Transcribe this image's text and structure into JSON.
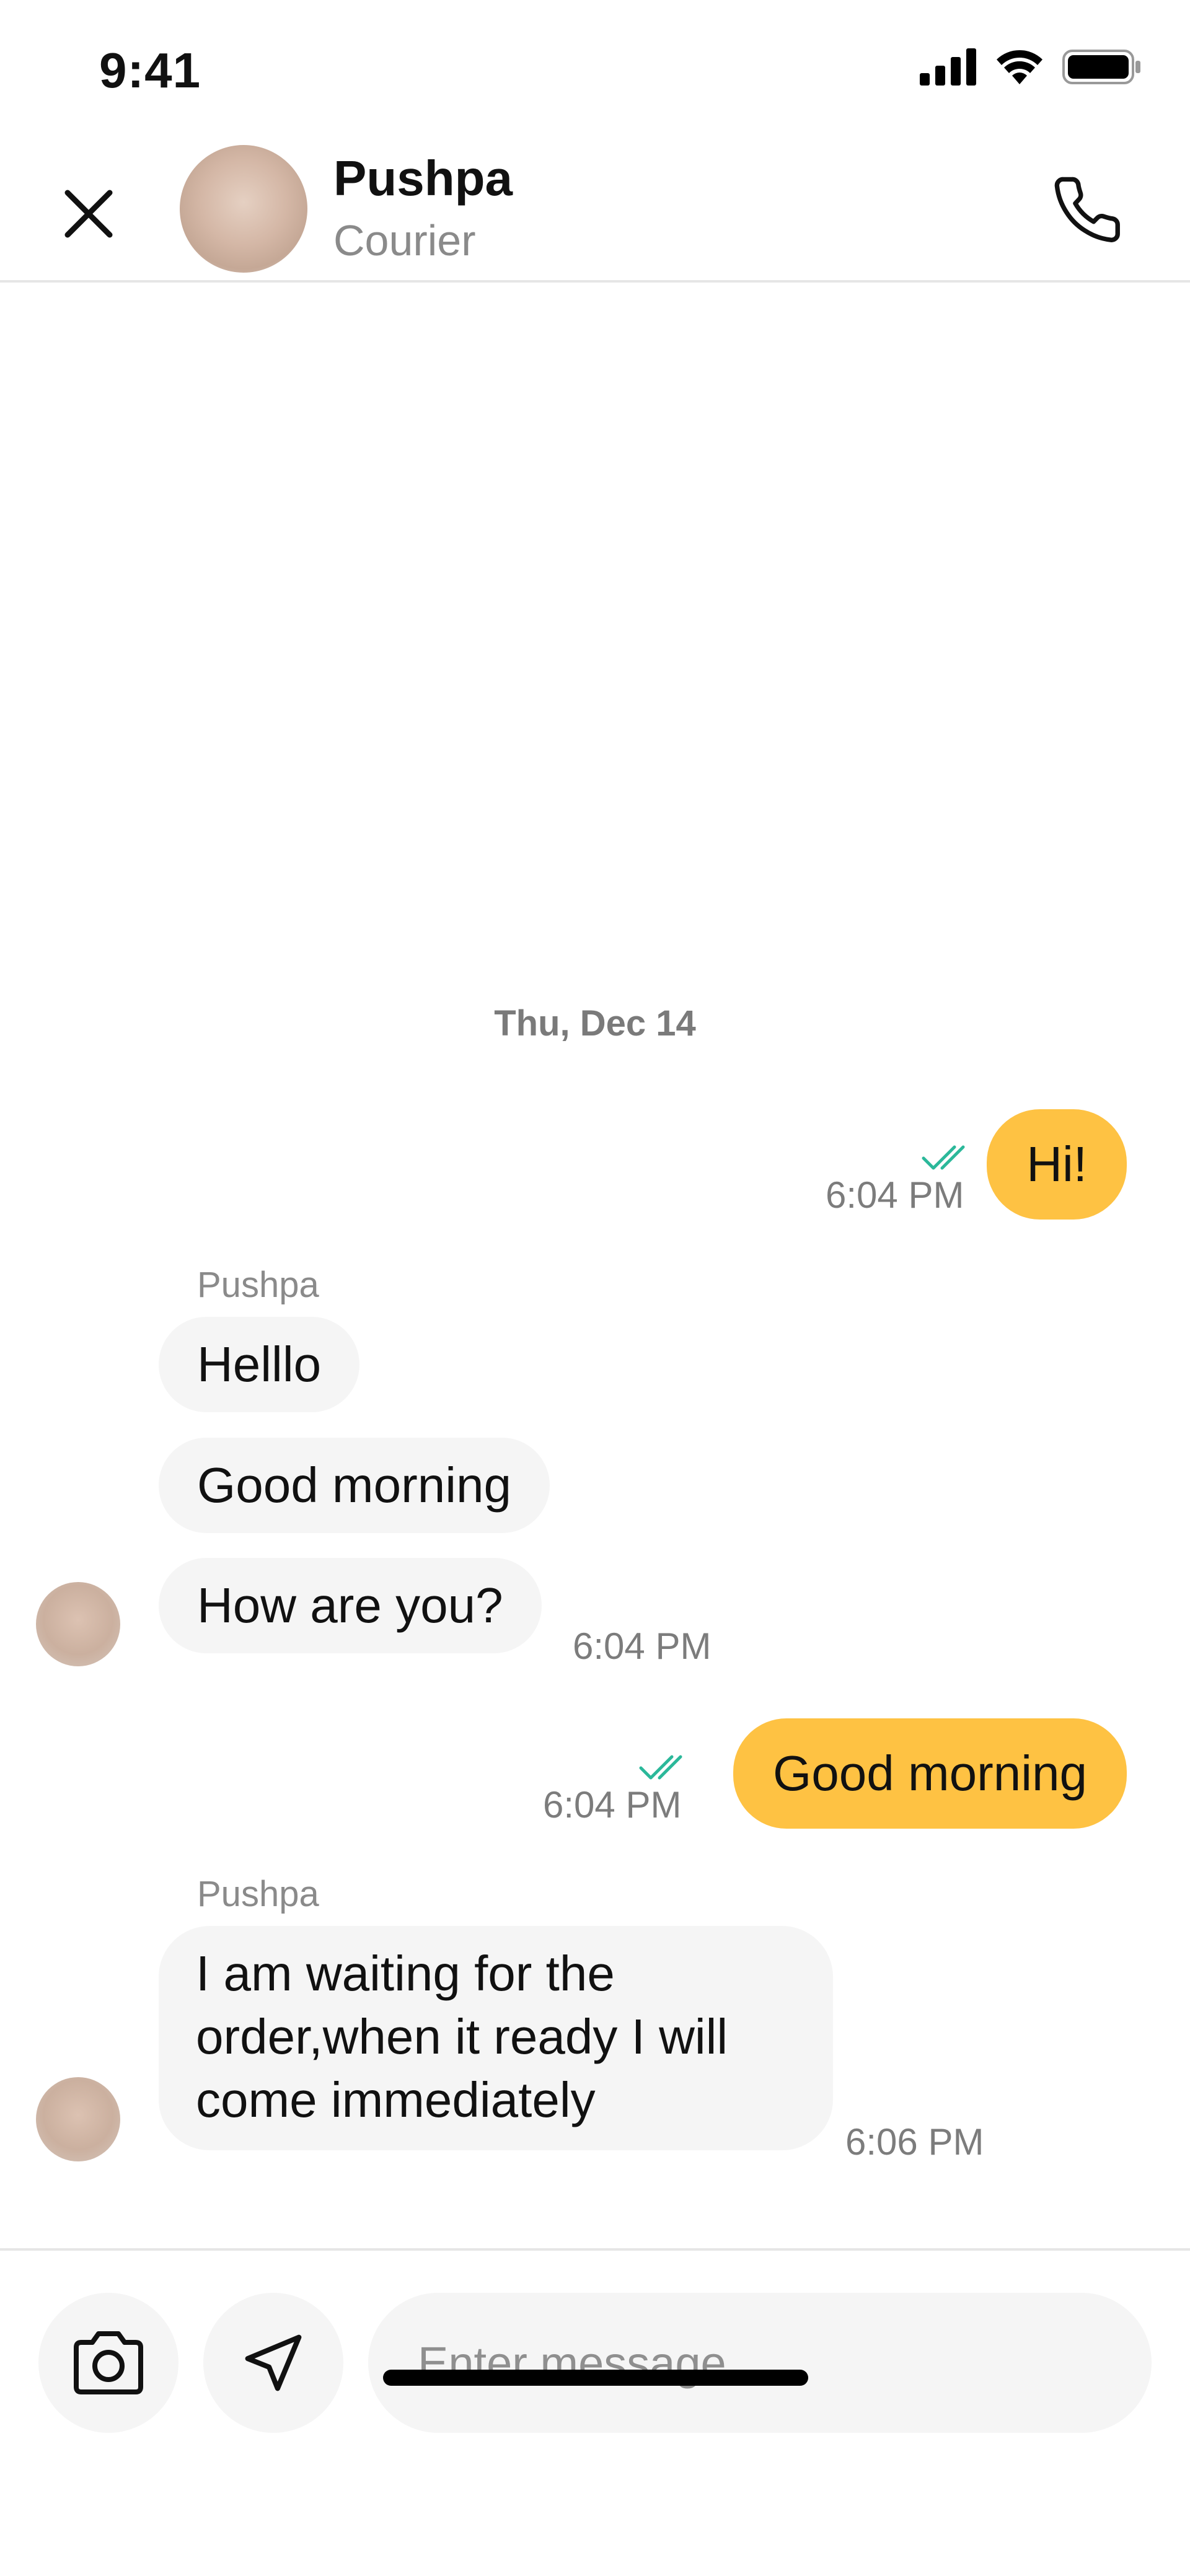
{
  "status_bar": {
    "time": "9:41",
    "icons": [
      "cellular-signal-icon",
      "wifi-icon",
      "battery-icon"
    ]
  },
  "header": {
    "contact_name": "Pushpa",
    "contact_role": "Courier",
    "icons": {
      "close": "close-icon",
      "call": "phone-icon"
    }
  },
  "chat": {
    "date_divider": "Thu, Dec 14",
    "messages": [
      {
        "direction": "outgoing",
        "text": "Hi!",
        "time": "6:04 PM",
        "status": "read"
      },
      {
        "direction": "incoming",
        "sender": "Pushpa",
        "text": "Helllo"
      },
      {
        "direction": "incoming",
        "text": "Good morning"
      },
      {
        "direction": "incoming",
        "text": "How are you?",
        "time": "6:04 PM"
      },
      {
        "direction": "outgoing",
        "text": "Good morning",
        "time": "6:04 PM",
        "status": "read"
      },
      {
        "direction": "incoming",
        "sender": "Pushpa",
        "text": "I am waiting for the order,when it ready I will come immediately",
        "time": "6:06 PM"
      }
    ]
  },
  "composer": {
    "placeholder": "Enter message",
    "icons": {
      "camera": "camera-icon",
      "location": "location-arrow-icon"
    }
  },
  "colors": {
    "outgoing_bubble": "#fec243",
    "incoming_bubble": "#f5f5f5",
    "read_check": "#2bb89a",
    "secondary_text": "#8a8a8a"
  }
}
